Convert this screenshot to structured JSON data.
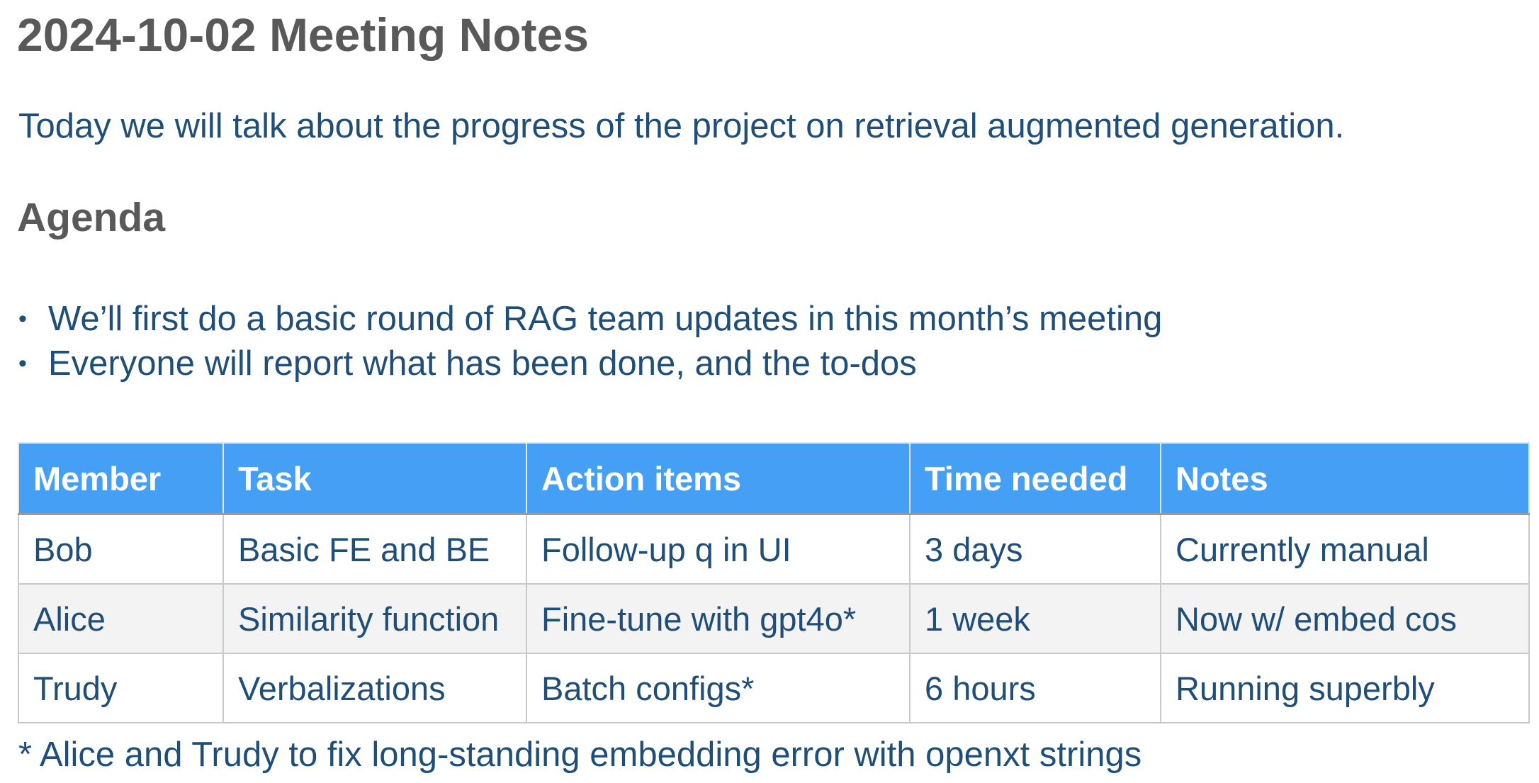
{
  "document": {
    "title": "2024-10-02 Meeting Notes",
    "intro": "Today we will talk about the progress of the project on retrieval augmented generation.",
    "agenda_heading": "Agenda",
    "agenda_items": [
      "We’ll first do a basic round of RAG team updates in this month’s meeting",
      "Everyone will report what has been done, and the to-dos"
    ],
    "bullet_char": "•",
    "table": {
      "headers": [
        "Member",
        "Task",
        "Action items",
        "Time needed",
        "Notes"
      ],
      "rows": [
        [
          "Bob",
          "Basic FE and BE",
          "Follow-up q in UI",
          "3 days",
          "Currently manual"
        ],
        [
          "Alice",
          "Similarity function",
          "Fine-tune with gpt4o*",
          "1 week",
          "Now w/ embed cos"
        ],
        [
          "Trudy",
          "Verbalizations",
          "Batch configs*",
          "6 hours",
          "Running superbly"
        ]
      ]
    },
    "footnote": "* Alice and Trudy to fix long-standing embedding error with openxt strings"
  },
  "colors": {
    "heading_text": "#595959",
    "body_text": "#1f4e79",
    "table_header_bg": "#459ff5",
    "table_header_text": "#ffffff",
    "table_row_alt_bg": "#f3f3f3",
    "table_border": "#c9c9c9"
  }
}
